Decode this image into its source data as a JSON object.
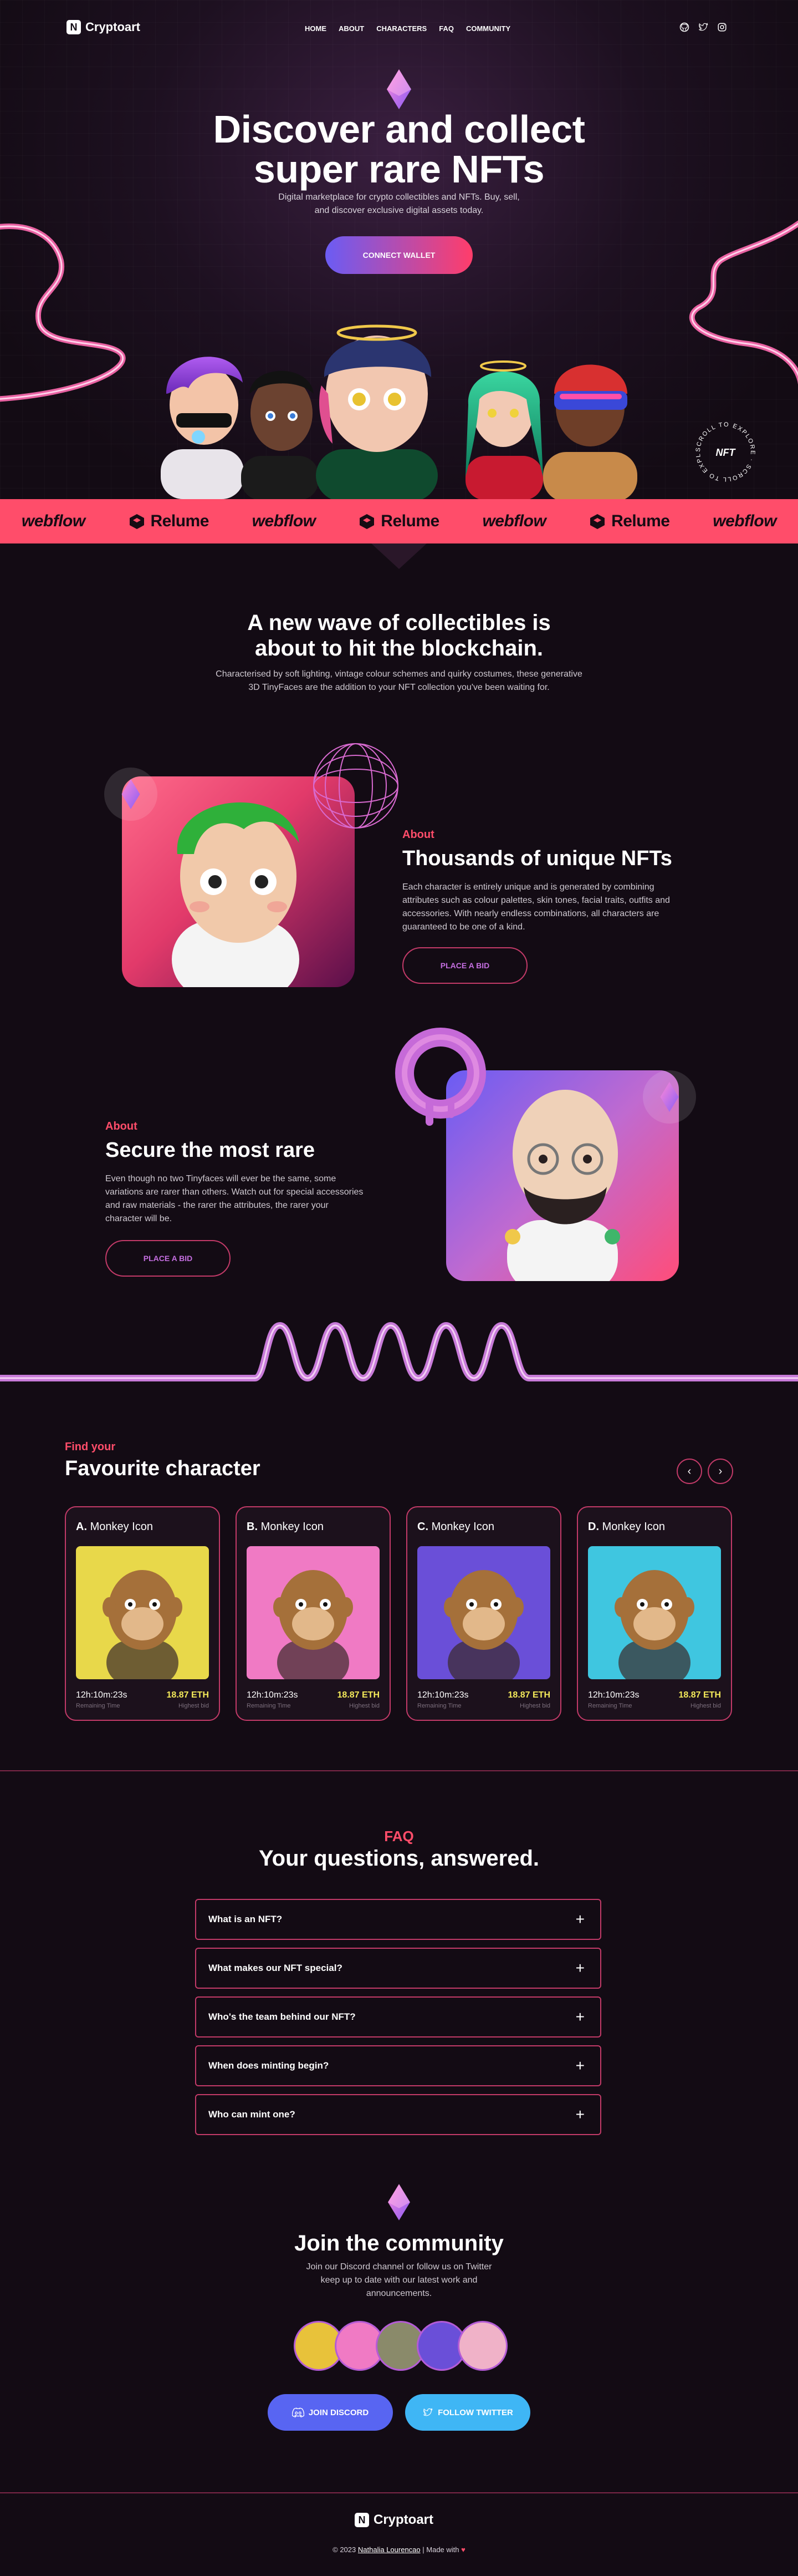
{
  "header": {
    "logo_text": "Cryptoart",
    "logo_letter": "N",
    "nav": [
      "HOME",
      "ABOUT",
      "CHARACTERS",
      "FAQ",
      "COMMUNITY"
    ],
    "social_icons": [
      "github-icon",
      "twitter-icon",
      "instagram-icon"
    ]
  },
  "hero": {
    "title_line1": "Discover and collect",
    "title_line2": "super rare NFTs",
    "subtitle_line1": "Digital marketplace for crypto collectibles and NFTs. Buy, sell,",
    "subtitle_line2": "and discover exclusive digital assets today.",
    "cta": "CONNECT WALLET",
    "badge_ring": "SCROLL TO EXPLORE · SCROLL TO EXPLORE ·",
    "badge_center": "NFT"
  },
  "marquee": {
    "brands": [
      "webflow",
      "Relume",
      "webflow",
      "Relume",
      "webflow",
      "Relume",
      "webflow"
    ]
  },
  "intro": {
    "title_line1": "A new wave of collectibles is",
    "title_line2": "about to hit the blockchain.",
    "text_line1": "Characterised by soft lighting, vintage colour schemes and quirky costumes, these generative",
    "text_line2": "3D TinyFaces are the addition to your NFT collection you've been waiting for."
  },
  "about1": {
    "kicker": "About",
    "title": "Thousands of unique NFTs",
    "text": "Each character is entirely unique and is generated by combining attributes such as colour palettes, skin tones, facial traits, outfits and accessories. With nearly endless combinations, all characters are guaranteed to be one of a kind.",
    "button": "PLACE A BID"
  },
  "about2": {
    "kicker": "About",
    "title": "Secure the most rare",
    "text": "Even though no two Tinyfaces will ever be the same, some variations are rarer than others. Watch out for special accessories and raw materials - the rarer the attributes, the rarer your character will be.",
    "button": "PLACE A BID"
  },
  "collection": {
    "kicker": "Find your",
    "title": "Favourite character",
    "prev": "‹",
    "next": "›",
    "cards": [
      {
        "letter": "A.",
        "name": "Monkey Icon",
        "time": "12h:10m:23s",
        "eth": "18.87 ETH",
        "time_label": "Remaining Time",
        "eth_label": "Highest bid",
        "bg": "#e8d84a"
      },
      {
        "letter": "B.",
        "name": "Monkey Icon",
        "time": "12h:10m:23s",
        "eth": "18.87 ETH",
        "time_label": "Remaining Time",
        "eth_label": "Highest bid",
        "bg": "#f07ac4"
      },
      {
        "letter": "C.",
        "name": "Monkey Icon",
        "time": "12h:10m:23s",
        "eth": "18.87 ETH",
        "time_label": "Remaining Time",
        "eth_label": "Highest bid",
        "bg": "#6a4fd8"
      },
      {
        "letter": "D.",
        "name": "Monkey Icon",
        "time": "12h:10m:23s",
        "eth": "18.87 ETH",
        "time_label": "Remaining Time",
        "eth_label": "Highest bid",
        "bg": "#3fc6e0"
      }
    ]
  },
  "faq": {
    "kicker": "FAQ",
    "title": "Your questions, answered.",
    "items": [
      "What is an NFT?",
      "What makes our NFT special?",
      "Who's the team behind our NFT?",
      "When does minting begin?",
      "Who can mint one?"
    ],
    "expand_symbol": "+"
  },
  "community": {
    "title": "Join the community",
    "text_line1": "Join our Discord channel or follow us on Twitter",
    "text_line2": "keep up to date with our latest work and",
    "text_line3": "announcements.",
    "discord": "JOIN DISCORD",
    "twitter": "FOLLOW TWITTER"
  },
  "footer": {
    "logo_text": "Cryptoart",
    "copyright": "© 2023",
    "author": "Nathalia Lourencao",
    "made_with": "| Made with",
    "heart": "♥"
  },
  "colors": {
    "accent": "#ff4d6a",
    "background": "#130b14",
    "border": "#c23a68",
    "eth_price": "#f4ea5a",
    "discord": "#5865f2",
    "twitter": "#3fb6f5"
  }
}
